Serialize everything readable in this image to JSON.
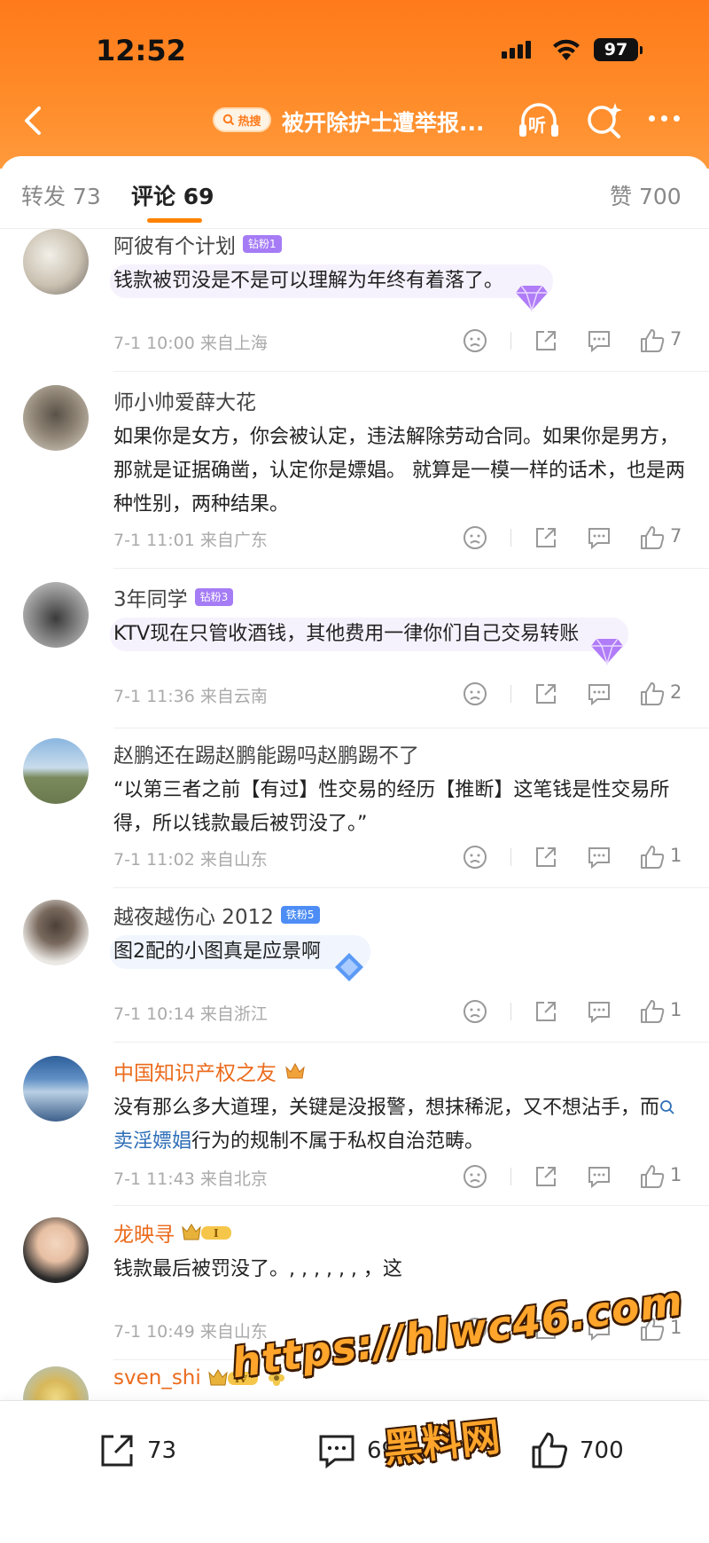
{
  "status_bar": {
    "time": "12:52",
    "battery": "97"
  },
  "nav": {
    "hot_badge": "热搜",
    "title": "被开除护士遭举报...",
    "listen_label": "听"
  },
  "tabs": {
    "repost": "转发 73",
    "comments": "评论 69",
    "likes": "赞 700"
  },
  "comments": [
    {
      "name": "阿彼有个计划",
      "badge": "钻粉1",
      "text": "钱款被罚没是不是可以理解为年终有着落了。",
      "time": "7-1 10:00",
      "location": "来自上海",
      "likes": "7"
    },
    {
      "name": "师小帅爱薛大花",
      "text": "如果你是女方，你会被认定，违法解除劳动合同。如果你是男方，那就是证据确凿，认定你是嫖娼。 就算是一模一样的话术，也是两种性别，两种结果。",
      "time": "7-1 11:01",
      "location": "来自广东",
      "likes": "7"
    },
    {
      "name": "3年同学",
      "badge": "钻粉3",
      "text": "KTV现在只管收酒钱，其他费用一律你们自己交易转账",
      "time": "7-1 11:36",
      "location": "来自云南",
      "likes": "2"
    },
    {
      "name": "赵鹏还在踢赵鹏能踢吗赵鹏踢不了",
      "text": "“以第三者之前【有过】性交易的经历【推断】这笔钱是性交易所得，所以钱款最后被罚没了。”",
      "time": "7-1 11:02",
      "location": "来自山东",
      "likes": "1"
    },
    {
      "name": "越夜越伤心 2012",
      "badge": "铁粉5",
      "text": "图2配的小图真是应景啊",
      "time": "7-1 10:14",
      "location": "来自浙江",
      "likes": "1"
    },
    {
      "name": "中国知识产权之友",
      "text_before": "没有那么多大道理，关键是没报警，想抹稀泥，又不想沾手，而",
      "topic": "卖淫嫖娼",
      "text_after": "行为的规制不属于私权自治范畴。",
      "time": "7-1 11:43",
      "location": "来自北京",
      "likes": "1"
    },
    {
      "name": "龙映寻",
      "text": "钱款最后被罚没了。, , , , , , ，这",
      "time": "7-1 10:49",
      "location": "来自山东",
      "likes": "1"
    },
    {
      "name": "sven_shi",
      "level": "IV"
    }
  ],
  "bottom_bar": {
    "repost": "73",
    "comment": "69",
    "like": "700"
  },
  "watermark": {
    "url": "https://hlwc46.com",
    "name": "黑料网"
  },
  "colors": {
    "accent": "#ff8200",
    "orange_name": "#eb6b1c",
    "link": "#2f6fb8"
  }
}
